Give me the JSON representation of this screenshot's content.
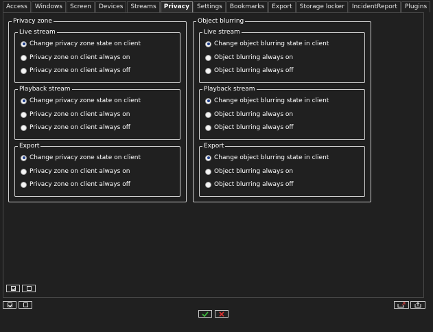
{
  "tabs": [
    {
      "label": "Access",
      "active": false
    },
    {
      "label": "Windows",
      "active": false
    },
    {
      "label": "Screen",
      "active": false
    },
    {
      "label": "Devices",
      "active": false
    },
    {
      "label": "Streams",
      "active": false
    },
    {
      "label": "Privacy",
      "active": true
    },
    {
      "label": "Settings",
      "active": false
    },
    {
      "label": "Bookmarks",
      "active": false
    },
    {
      "label": "Export",
      "active": false
    },
    {
      "label": "Storage locker",
      "active": false
    },
    {
      "label": "IncidentReport",
      "active": false
    },
    {
      "label": "Plugins",
      "active": false
    }
  ],
  "privacy_zone": {
    "title": "Privacy zone",
    "live": {
      "title": "Live stream",
      "options": [
        "Change privacy zone state on client",
        "Privacy zone on client always on",
        "Privacy zone on client always off"
      ],
      "selected": 0
    },
    "playback": {
      "title": "Playback stream",
      "options": [
        "Change privacy zone state on client",
        "Privacy zone on client always on",
        "Privacy zone on client always off"
      ],
      "selected": 0
    },
    "export": {
      "title": "Export",
      "options": [
        "Change privacy zone state on client",
        "Privacy zone on client always on",
        "Privacy zone on client always off"
      ],
      "selected": 0
    }
  },
  "object_blurring": {
    "title": "Object blurring",
    "live": {
      "title": "Live stream",
      "options": [
        "Change object blurring state in client",
        "Object blurring always on",
        "Object blurring always off"
      ],
      "selected": 0
    },
    "playback": {
      "title": "Playback stream",
      "options": [
        "Change object blurring state in client",
        "Object blurring always on",
        "Object blurring always off"
      ],
      "selected": 0
    },
    "export": {
      "title": "Export",
      "options": [
        "Change object blurring state in client",
        "Object blurring always on",
        "Object blurring always off"
      ],
      "selected": 0
    }
  },
  "colors": {
    "background": "#202020",
    "ok_green": "#3cb43c",
    "cancel_red": "#e03030",
    "import_red": "#d04040"
  }
}
